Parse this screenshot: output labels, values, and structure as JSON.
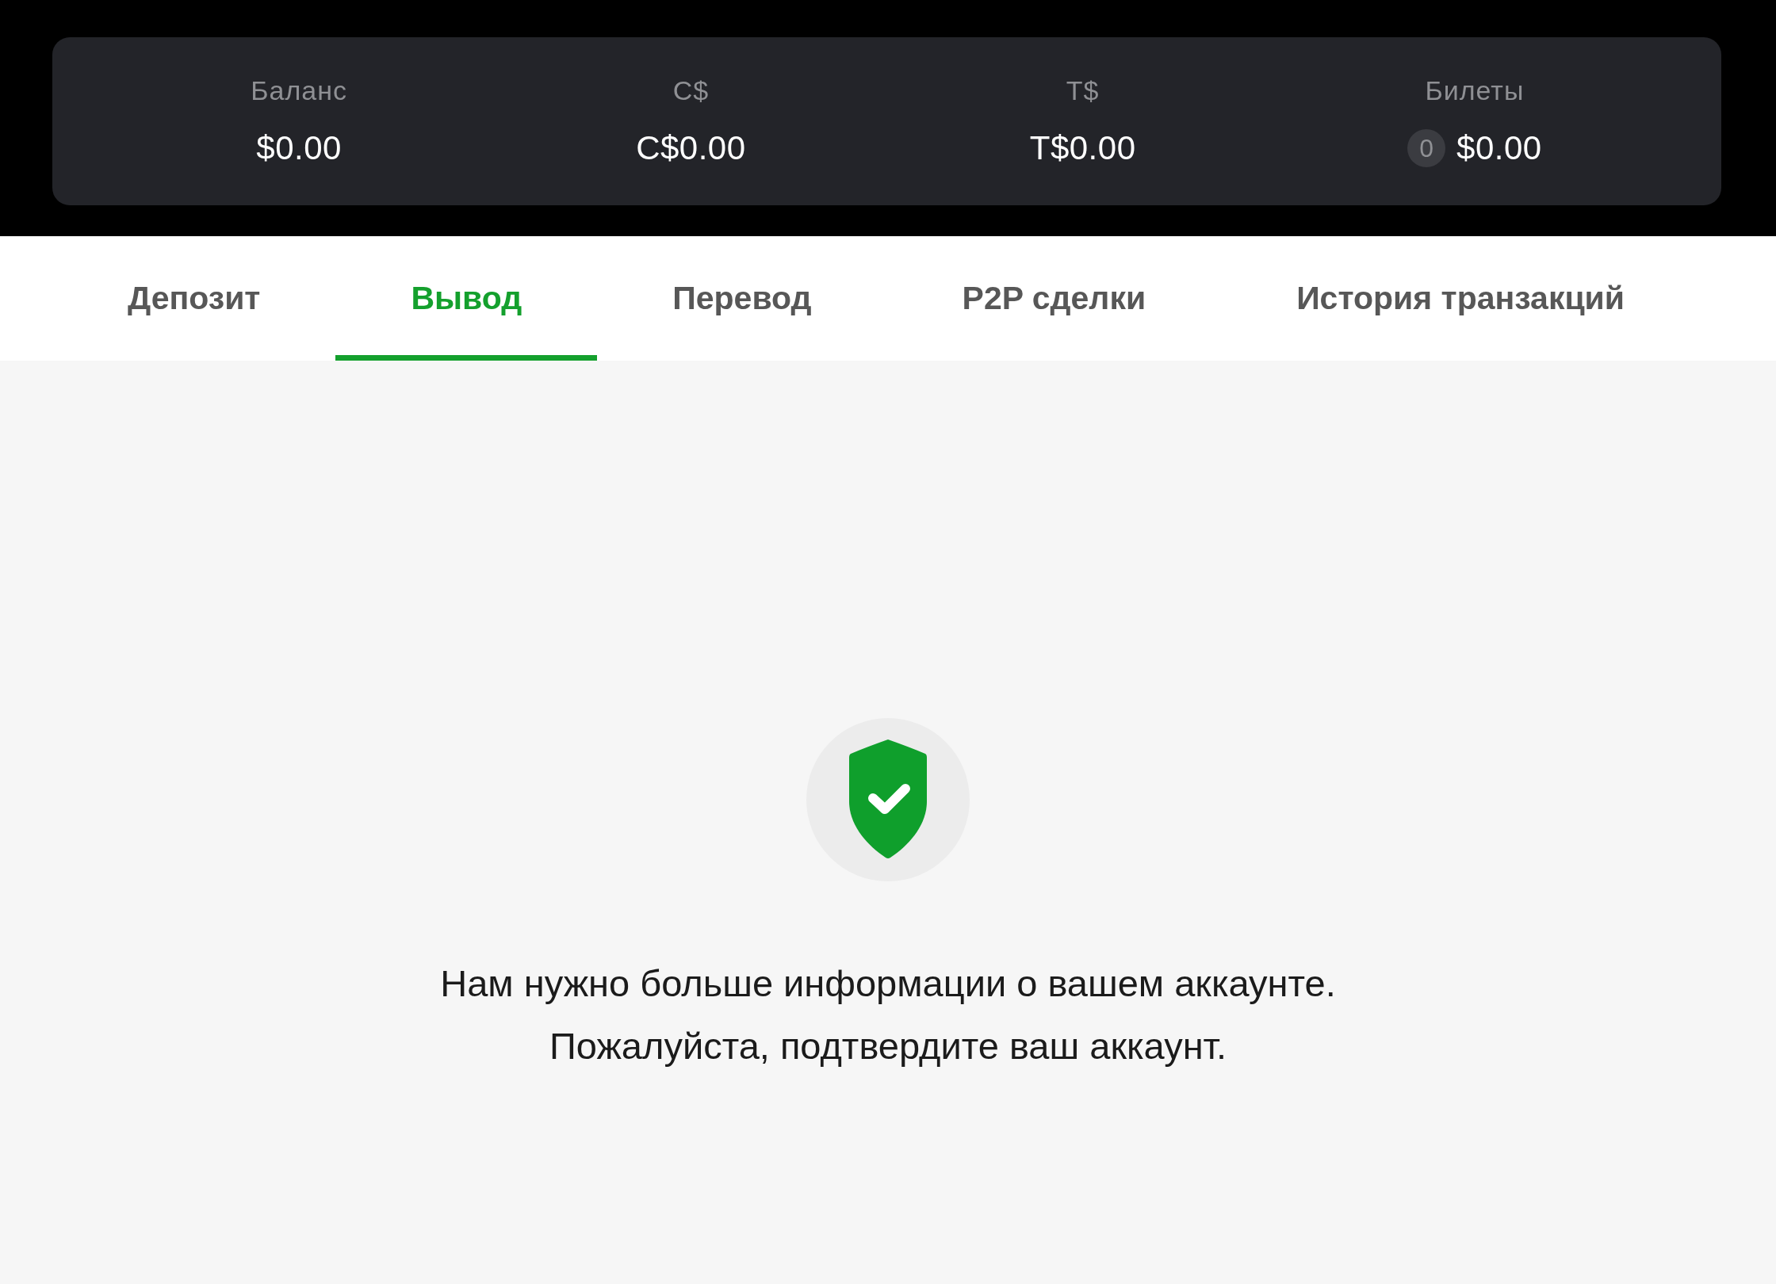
{
  "balances": [
    {
      "label": "Баланс",
      "value": "$0.00"
    },
    {
      "label": "C$",
      "value": "C$0.00"
    },
    {
      "label": "T$",
      "value": "T$0.00"
    },
    {
      "label": "Билеты",
      "count": "0",
      "value": "$0.00"
    }
  ],
  "tabs": [
    {
      "label": "Депозит",
      "selected": false
    },
    {
      "label": "Вывод",
      "selected": true
    },
    {
      "label": "Перевод",
      "selected": false
    },
    {
      "label": "P2P сделки",
      "selected": false
    },
    {
      "label": "История транзакций",
      "selected": false
    }
  ],
  "message": {
    "lines": [
      "Нам нужно больше информации о вашем аккаунте.",
      "Пожалуйста, подтвердите ваш аккаунт."
    ]
  }
}
